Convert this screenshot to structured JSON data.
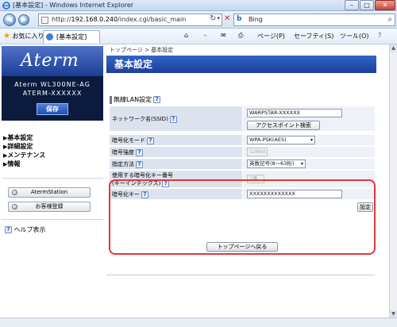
{
  "window": {
    "title": "[基本設定] - Windows Internet Explorer",
    "minimize": "–",
    "maximize": "□",
    "close": "✕"
  },
  "addressbar": {
    "back": "◀",
    "forward": "▶",
    "url_prefix": "http://",
    "url_host": "192.168.0.240",
    "url_path": "/index.cgi/basic_main",
    "dropdown": "▾",
    "refresh_icon": "↻",
    "stop_icon": "✕",
    "search_engine": "b",
    "search_text": "Bing",
    "search_icon": "⌕"
  },
  "commandbar": {
    "favorites": "お気に入り",
    "tab_label": "[基本設定]",
    "page_menu": "ページ(P)",
    "safety_menu": "セーフティ(S)",
    "tools_menu": "ツール(O)",
    "help_icon": "?",
    "home_icon": "⌂",
    "feeds_icon": "⌁",
    "mail_icon": "✉",
    "print_icon": "⎙"
  },
  "sidebar": {
    "logo": "Aterm",
    "model_line1": "Aterm WL300NE-AG",
    "model_line2": "ATERM-XXXXXX",
    "save_button": "保存",
    "menu": [
      {
        "label": "基本設定"
      },
      {
        "label": "詳細設定"
      },
      {
        "label": "メンテナンス"
      },
      {
        "label": "情報"
      }
    ],
    "menu_arrow": "▶",
    "buttons": [
      {
        "label": "AtermStation"
      },
      {
        "label": "お客様登録"
      }
    ],
    "help": "ヘルプ表示"
  },
  "main": {
    "breadcrumb": "トップページ > 基本設定",
    "title": "基本設定",
    "section": "無線LAN設定",
    "qmark": "?",
    "ssid_label": "ネットワーク名(SSID)",
    "ssid_value": "WARPSTAR-XXXXXX",
    "ap_search_button": "アクセスポイント検索",
    "enc_mode_label": "暗号化モード",
    "enc_mode_value": "WPA-PSK(AES)",
    "enc_strength_label": "暗号強度",
    "enc_strength_value": "128bit",
    "method_label": "指定方法",
    "method_value": "英数記号(8〜63桁)",
    "keyindex_label_1": "使用する暗号化キー番号",
    "keyindex_label_2": "(キーインデックス)",
    "keyindex_value": "1番",
    "key_label": "暗号化キー",
    "key_value": "XXXXXXXXXXXXX",
    "set_button": "設定",
    "back_button": "トップページへ戻る",
    "select_caret": "▾"
  }
}
